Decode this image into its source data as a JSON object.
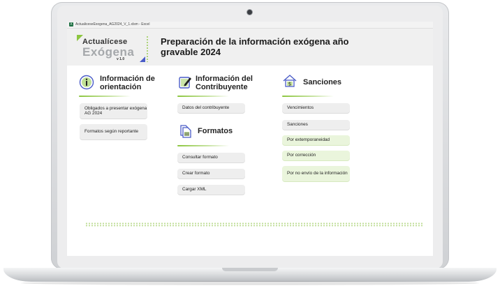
{
  "window": {
    "title": "ActualiceseExogena_AG2024_V_1.xlsm - Excel",
    "app_icon": "X"
  },
  "logo": {
    "line1": "Actualícese",
    "line2": "Exógena",
    "version": "v 1.0"
  },
  "header": {
    "title": "Preparación de la información exógena año gravable 2024"
  },
  "sections": {
    "orientacion": {
      "title": "Información de orientación",
      "icon": "info-icon",
      "buttons": [
        "Obligados a presentar exógena AG 2024",
        "Formatos según reportante"
      ]
    },
    "contribuyente": {
      "title": "Información del Contribuyente",
      "icon": "edit-document-icon",
      "buttons": [
        "Datos del contribuyente"
      ]
    },
    "formatos": {
      "title": "Formatos",
      "icon": "documents-icon",
      "buttons": [
        "Consultar formato",
        "Crear formato",
        "Cargar XML"
      ]
    },
    "sanciones": {
      "title": "Sanciones",
      "icon": "house-money-icon",
      "buttons": [
        "Vencimientos",
        "Sanciones",
        "Por extemporaneidad",
        "Por corrección",
        "Por no envío de la información"
      ]
    }
  },
  "colors": {
    "accent_green": "#8cc63f",
    "accent_blue": "#4a5cc7",
    "button_gray": "#eeeeee",
    "button_green": "#eaf5dc"
  }
}
